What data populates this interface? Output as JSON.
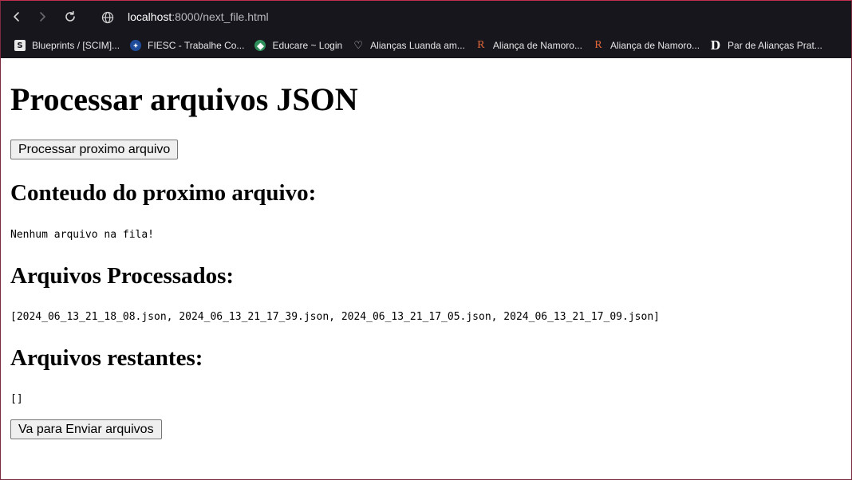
{
  "browser": {
    "url_host": "localhost",
    "url_rest": ":8000/next_file.html",
    "bookmarks": [
      {
        "label": "Blueprints / [SCIM]...",
        "icon": "s-badge-icon"
      },
      {
        "label": "FIESC - Trabalhe Co...",
        "icon": "fiesc-icon"
      },
      {
        "label": "Educare ~ Login",
        "icon": "educare-icon"
      },
      {
        "label": "Alianças Luanda am...",
        "icon": "heart-icon"
      },
      {
        "label": "Aliança de Namoro...",
        "icon": "r-logo-icon"
      },
      {
        "label": "Aliança de Namoro...",
        "icon": "r-logo-icon"
      },
      {
        "label": "Par de Alianças Prat...",
        "icon": "d-logo-icon"
      }
    ]
  },
  "page": {
    "title": "Processar arquivos JSON",
    "process_button": "Processar proximo arquivo",
    "next_heading": "Conteudo do proximo arquivo:",
    "next_content": "Nenhum arquivo na fila!",
    "processed_heading": "Arquivos Processados:",
    "processed_list": "[2024_06_13_21_18_08.json, 2024_06_13_21_17_39.json, 2024_06_13_21_17_05.json, 2024_06_13_21_17_09.json]",
    "remaining_heading": "Arquivos restantes:",
    "remaining_list": "[]",
    "send_button": "Va para Enviar arquivos"
  }
}
